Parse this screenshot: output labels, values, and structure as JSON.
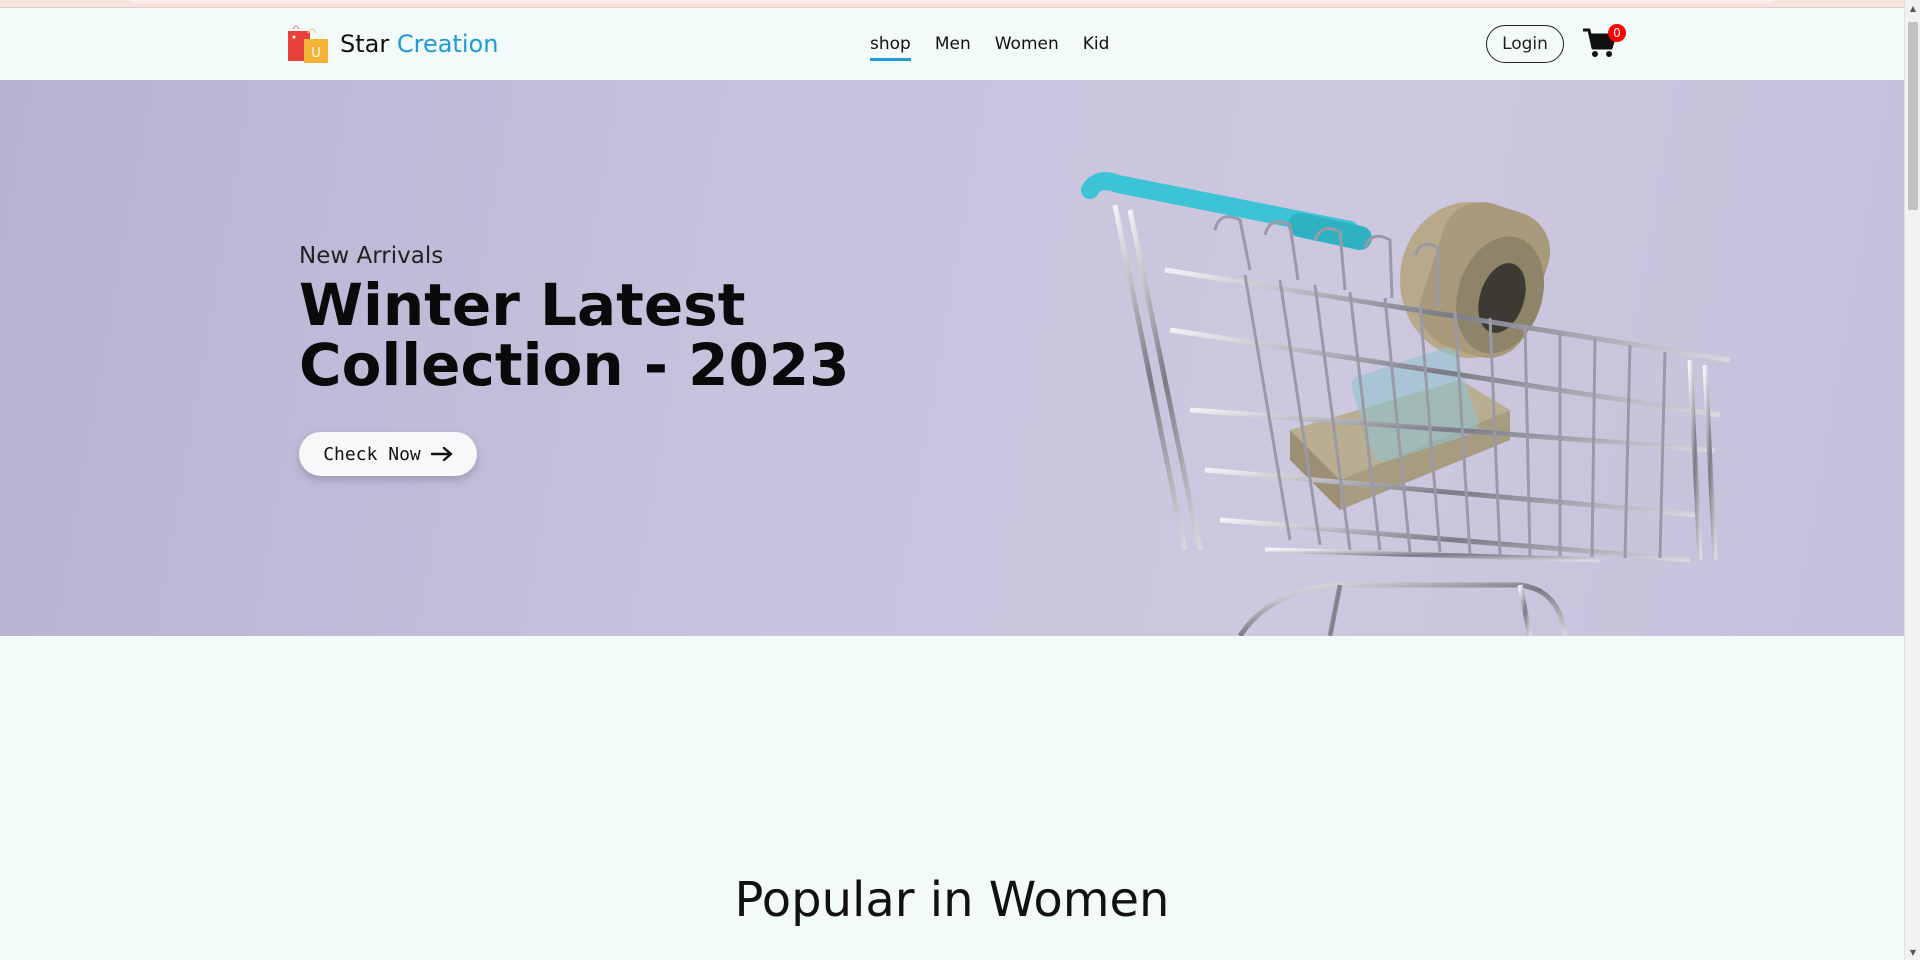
{
  "brand": {
    "name_part1": "Star",
    "name_part2": "Creation",
    "logo_letter": "U"
  },
  "nav": {
    "links": [
      {
        "label": "shop",
        "active": true
      },
      {
        "label": "Men",
        "active": false
      },
      {
        "label": "Women",
        "active": false
      },
      {
        "label": "Kid",
        "active": false
      }
    ],
    "login_label": "Login",
    "cart_count": "0"
  },
  "hero": {
    "eyebrow": "New Arrivals",
    "title": "Winter Latest Collection - 2023",
    "button_label": "Check Now",
    "button_icon": "arrow-right-icon"
  },
  "popular": {
    "title": "Popular in Women"
  },
  "colors": {
    "accent": "#1e9ad6",
    "badge": "#ff0000",
    "page_bg": "#f2fbf9",
    "hero_bg": "#c7c3dd",
    "cart_handle": "#3cc3d6"
  }
}
